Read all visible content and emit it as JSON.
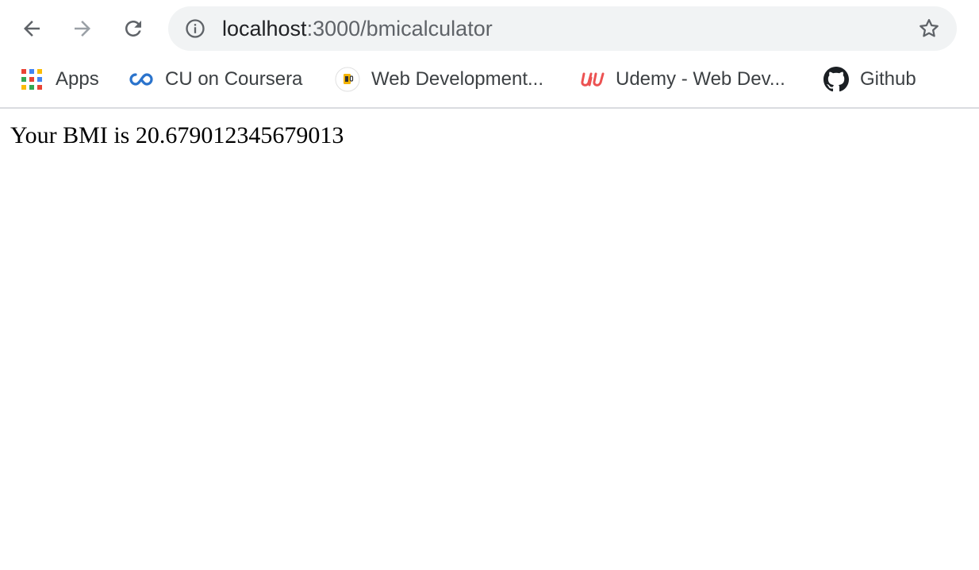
{
  "browser": {
    "omnibox": {
      "host": "localhost",
      "path": ":3000/bmicalculator"
    },
    "bookmarks": [
      {
        "label": "Apps",
        "icon": "apps-grid-icon"
      },
      {
        "label": "CU on Coursera",
        "icon": "coursera-icon"
      },
      {
        "label": "Web Development...",
        "icon": "web-development-favicon"
      },
      {
        "label": "Udemy - Web Dev...",
        "icon": "udemy-icon"
      },
      {
        "label": "Github",
        "icon": "github-icon"
      }
    ]
  },
  "page": {
    "result_text": "Your BMI is 20.679012345679013"
  },
  "colors": {
    "chrome_bg": "#ffffff",
    "omnibox_bg": "#f1f3f4",
    "icon_gray": "#5f6368",
    "icon_disabled": "#9aa0a6",
    "coursera_blue": "#2a73cc",
    "udemy_red": "#ec5252"
  }
}
